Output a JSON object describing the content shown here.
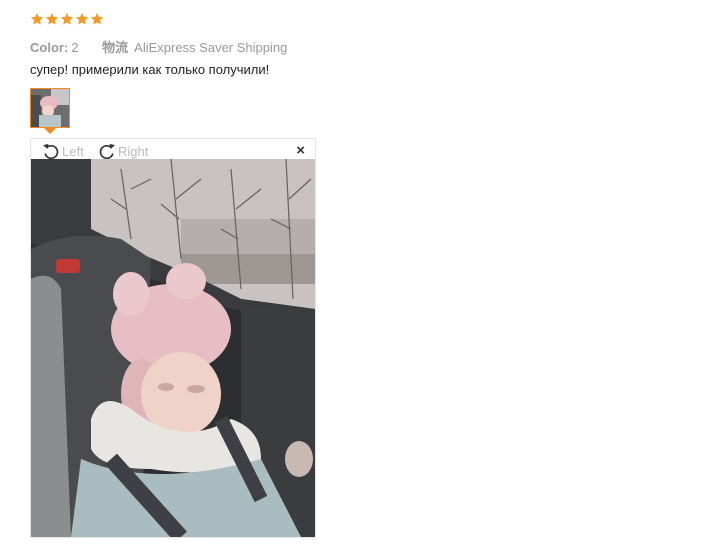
{
  "rating": {
    "stars": 5,
    "max": 5,
    "star_color": "#f59a23"
  },
  "review": {
    "color_label": "Color:",
    "color_value": "2",
    "shipping_label": "物流",
    "shipping_value": "AliExpress Saver Shipping",
    "text": "супер! примерили как только получили!"
  },
  "viewer": {
    "rotate_left_label": "Left",
    "rotate_right_label": "Right",
    "close_symbol": "×",
    "accent_color": "#f08a24"
  }
}
